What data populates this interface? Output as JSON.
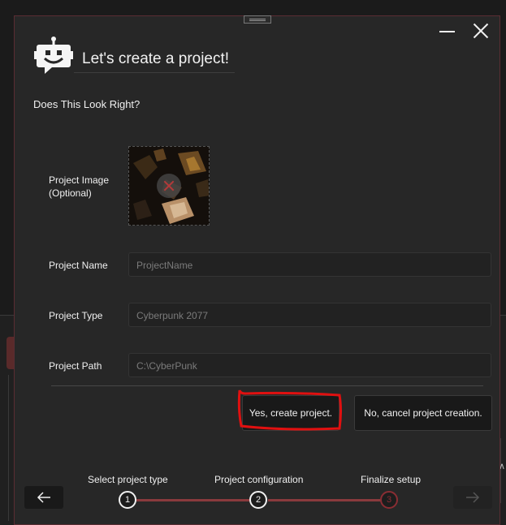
{
  "dialog": {
    "title": "Let's create a project!",
    "subtitle": "Does This Look Right?",
    "accent": "#8a3a3d"
  },
  "fields": {
    "image_label_line1": "Project Image",
    "image_label_line2": "(Optional)",
    "name_label": "Project Name",
    "name_value": "ProjectName",
    "type_label": "Project Type",
    "type_value": "Cyberpunk 2077",
    "path_label": "Project Path",
    "path_value": "C:\\CyberPunk"
  },
  "actions": {
    "yes_label": "Yes, create project.",
    "no_label": "No, cancel project creation."
  },
  "steps": [
    {
      "number": "1",
      "label": "Select project type"
    },
    {
      "number": "2",
      "label": "Project configuration"
    },
    {
      "number": "3",
      "label": "Finalize setup"
    }
  ],
  "icons": {
    "logo": "robot-chat-icon",
    "back": "arrow-left-icon",
    "next": "arrow-right-icon",
    "clear": "close-icon"
  }
}
